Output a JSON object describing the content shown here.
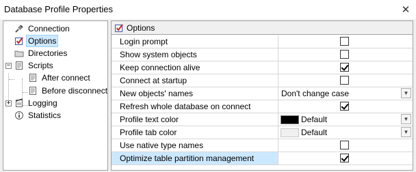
{
  "window": {
    "title": "Database Profile Properties",
    "close_glyph": "✕"
  },
  "tree": {
    "items": [
      {
        "label": "Connection",
        "icon": "plug-icon"
      },
      {
        "label": "Options",
        "icon": "checkbox-icon",
        "selected": true
      },
      {
        "label": "Directories",
        "icon": "folder-icon"
      },
      {
        "label": "Scripts",
        "icon": "script-icon",
        "expander": "−"
      },
      {
        "label": "After connect",
        "icon": "script-icon"
      },
      {
        "label": "Before disconnect",
        "icon": "script-icon"
      },
      {
        "label": "Logging",
        "icon": "log-icon",
        "expander": "+"
      },
      {
        "label": "Statistics",
        "icon": "info-icon"
      }
    ]
  },
  "panel": {
    "title": "Options",
    "icon": "checkbox-icon"
  },
  "options": [
    {
      "name": "Login prompt",
      "type": "checkbox",
      "checked": false
    },
    {
      "name": "Show system objects",
      "type": "checkbox",
      "checked": false
    },
    {
      "name": "Keep connection alive",
      "type": "checkbox",
      "checked": true
    },
    {
      "name": "Connect at startup",
      "type": "checkbox",
      "checked": false
    },
    {
      "name": "New objects' names",
      "type": "combo",
      "value": "Don't change case"
    },
    {
      "name": "Refresh whole database on connect",
      "type": "checkbox",
      "checked": true
    },
    {
      "name": "Profile text color",
      "type": "color",
      "value": "Default",
      "swatch": "#000000"
    },
    {
      "name": "Profile tab color",
      "type": "color",
      "value": "Default",
      "swatch": "#f0f0f0"
    },
    {
      "name": "Use native type names",
      "type": "checkbox",
      "checked": false
    },
    {
      "name": "Optimize table partition management",
      "type": "checkbox",
      "checked": true,
      "highlight": true
    }
  ],
  "colors": {
    "selection": "#cce8ff",
    "border": "#a0a0a0"
  }
}
